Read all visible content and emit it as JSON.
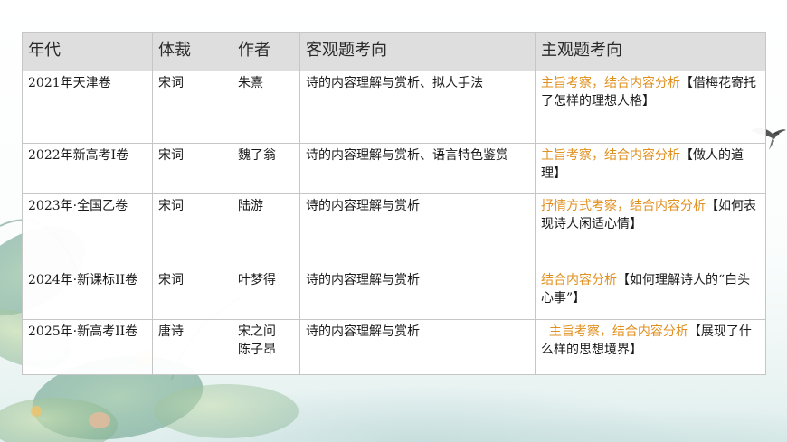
{
  "table": {
    "headers": [
      "年代",
      "体裁",
      "作者",
      "客观题考向",
      "主观题考向"
    ],
    "rows": [
      {
        "year": "2021年天津卷",
        "genre": "宋词",
        "author": "朱熹",
        "objective": "诗的内容理解与赏析、拟人手法",
        "subjective_highlight": "主旨考察，结合内容分析",
        "subjective_rest": "【借梅花寄托了怎样的理想人格】"
      },
      {
        "year": "2022年新高考I卷",
        "genre": "宋词",
        "author": "魏了翁",
        "objective": "诗的内容理解与赏析、语言特色鉴赏",
        "subjective_highlight": "主旨考察，结合内容分析",
        "subjective_rest": "【做人的道理】"
      },
      {
        "year": "2023年·全国乙卷",
        "genre": "宋词",
        "author": "陆游",
        "objective": "诗的内容理解与赏析",
        "subjective_highlight": "抒情方式考察，结合内容分析",
        "subjective_rest": "【如何表现诗人闲适心情】"
      },
      {
        "year": "2024年·新课标II卷",
        "genre": "宋词",
        "author": "叶梦得",
        "objective": "诗的内容理解与赏析",
        "subjective_highlight": "结合内容分析",
        "subjective_rest": "【如何理解诗人的“白头心事”】"
      },
      {
        "year": "2025年·新高考II卷",
        "genre": "唐诗",
        "author": "宋之问\n陈子昂",
        "objective": "诗的内容理解与赏析",
        "subjective_highlight": "  主旨考察，结合内容分析",
        "subjective_rest": "【展现了什么样的思想境界】"
      }
    ]
  },
  "colors": {
    "highlight": "#e0901f",
    "header_bg": "#dedede",
    "border": "#c6c6c6"
  },
  "decor": {
    "left_art": "lotus-leaf-illustration",
    "right_art": "swallow-bird-illustration"
  }
}
